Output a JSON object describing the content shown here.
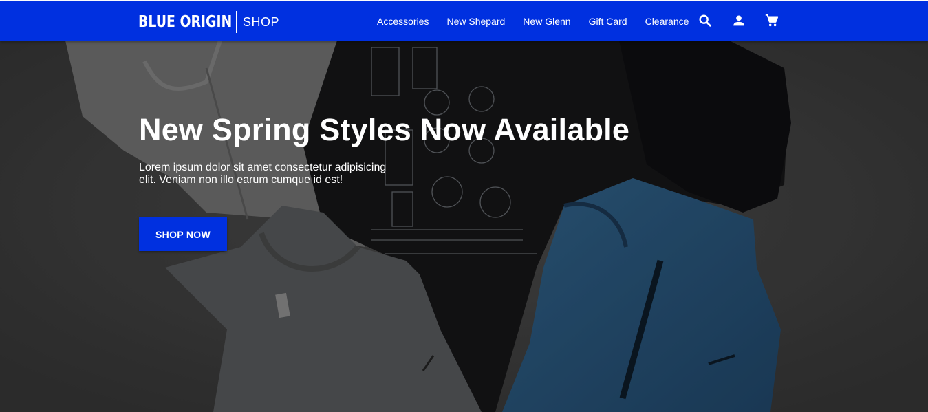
{
  "header": {
    "brand_name": "BLUE ORIGIN",
    "brand_sub": "SHOP",
    "nav": [
      {
        "label": "Accessories"
      },
      {
        "label": "New Shepard"
      },
      {
        "label": "New Glenn"
      },
      {
        "label": "Gift Card"
      },
      {
        "label": "Clearance"
      }
    ],
    "icons": [
      "search-icon",
      "account-icon",
      "cart-icon"
    ],
    "bar_color": "#0030e0"
  },
  "hero": {
    "title": "New Spring Styles Now Available",
    "text": "Lorem ipsum dolor sit amet consectetur adipisicing elit. Veniam non illo earum cumque id est!",
    "button_label": "SHOP NOW",
    "button_color": "#0030e0"
  }
}
